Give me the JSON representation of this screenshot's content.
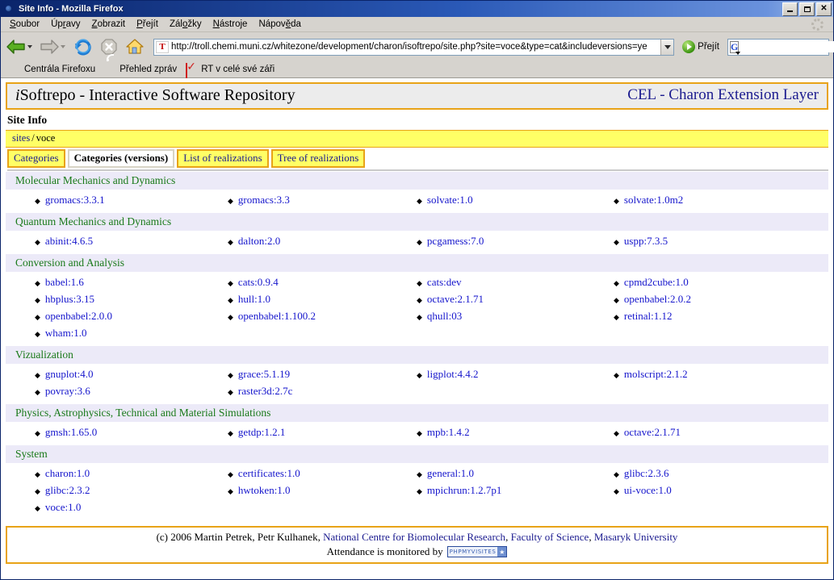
{
  "window": {
    "title": "Site Info - Mozilla Firefox",
    "icon": "firefox-logo",
    "minimize_label": "",
    "maximize_label": "",
    "close_label": "✕"
  },
  "menubar": {
    "items": [
      {
        "label": "Soubor",
        "accel": "S"
      },
      {
        "label": "Úpravy",
        "accel": "r"
      },
      {
        "label": "Zobrazit",
        "accel": "Z"
      },
      {
        "label": "Přejít",
        "accel": "P"
      },
      {
        "label": "Záložky",
        "accel": "o"
      },
      {
        "label": "Nástroje",
        "accel": "N"
      },
      {
        "label": "Nápověda",
        "accel": "ě"
      }
    ]
  },
  "toolbar": {
    "back_label": "Back",
    "forward_label": "Forward",
    "reload_label": "Reload",
    "stop_label": "Stop",
    "home_label": "Home",
    "url": "http://troll.chemi.muni.cz/whitezone/development/charon/isoftrepo/site.php?site=voce&type=cat&includeversions=ye",
    "url_favicon_letter": "T",
    "go_label": "Přejít",
    "search_engine_letter": "G",
    "search_value": "",
    "search_placeholder": ""
  },
  "bookmarks": [
    {
      "label": "Centrála Firefoxu",
      "icon": "firefox-head-icon"
    },
    {
      "label": "Přehled zpráv",
      "icon": "rss-icon"
    },
    {
      "label": "RT v celé své záři",
      "icon": "checkmark-icon"
    }
  ],
  "site": {
    "header_left_prefix": "i",
    "header_left": "Softrepo - Interactive Software Repository",
    "header_right": "CEL - Charon Extension Layer",
    "page_title": "Site Info",
    "breadcrumb_root": "sites",
    "breadcrumb_sep": "/",
    "breadcrumb_current": "voce"
  },
  "tabs": [
    {
      "label": "Categories",
      "active": false
    },
    {
      "label": "Categories (versions)",
      "active": true
    },
    {
      "label": "List of realizations",
      "active": false
    },
    {
      "label": "Tree of realizations",
      "active": false
    }
  ],
  "categories": [
    {
      "name": "Molecular Mechanics and Dynamics",
      "packages": [
        "gromacs:3.3.1",
        "gromacs:3.3",
        "solvate:1.0",
        "solvate:1.0m2"
      ]
    },
    {
      "name": "Quantum Mechanics and Dynamics",
      "packages": [
        "abinit:4.6.5",
        "dalton:2.0",
        "pcgamess:7.0",
        "uspp:7.3.5"
      ]
    },
    {
      "name": "Conversion and Analysis",
      "packages": [
        "babel:1.6",
        "cats:0.9.4",
        "cats:dev",
        "cpmd2cube:1.0",
        "hbplus:3.15",
        "hull:1.0",
        "octave:2.1.71",
        "openbabel:2.0.2",
        "openbabel:2.0.0",
        "openbabel:1.100.2",
        "qhull:03",
        "retinal:1.12",
        "wham:1.0"
      ]
    },
    {
      "name": "Vizualization",
      "packages": [
        "gnuplot:4.0",
        "grace:5.1.19",
        "ligplot:4.4.2",
        "molscript:2.1.2",
        "povray:3.6",
        "raster3d:2.7c"
      ]
    },
    {
      "name": "Physics, Astrophysics, Technical and Material Simulations",
      "packages": [
        "gmsh:1.65.0",
        "getdp:1.2.1",
        "mpb:1.4.2",
        "octave:2.1.71"
      ]
    },
    {
      "name": "System",
      "packages": [
        "charon:1.0",
        "certificates:1.0",
        "general:1.0",
        "glibc:2.3.6",
        "glibc:2.3.2",
        "hwtoken:1.0",
        "mpichrun:1.2.7p1",
        "ui-voce:1.0",
        "voce:1.0"
      ]
    }
  ],
  "footer": {
    "copyright": "(c) 2006 Martin Petrek, Petr Kulhanek,",
    "link1": "National Centre for Biomolecular Research",
    "comma1": ",",
    "link2": "Faculty of Science",
    "comma2": ",",
    "link3": "Masaryk University",
    "attendance": "Attendance is monitored by",
    "badge_text": "PHPMYVISITES"
  },
  "colors": {
    "accent_border": "#e8a317",
    "breadcrumb_bg": "#ffff66",
    "category_bg": "#eceaf8",
    "category_text": "#1a7a1a",
    "link": "#1515cc",
    "brand_blue": "#1b1b8f"
  }
}
